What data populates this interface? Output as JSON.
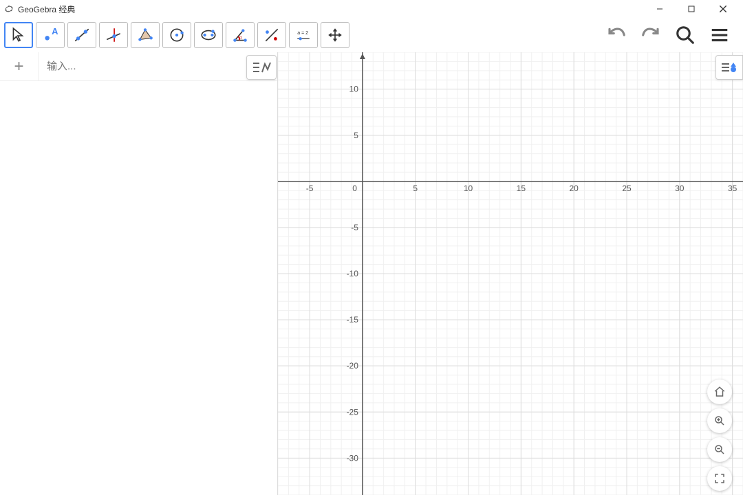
{
  "app": {
    "title": "GeoGebra 经典"
  },
  "toolbar": {
    "slider_label": "a = 2"
  },
  "input": {
    "placeholder": "输入..."
  },
  "chart_data": {
    "type": "scatter",
    "title": "",
    "xlabel": "",
    "ylabel": "",
    "x_ticks": [
      -5,
      0,
      5,
      10,
      15,
      20,
      25,
      30,
      35
    ],
    "y_ticks": [
      10,
      5,
      0,
      -5,
      -10,
      -15,
      -20,
      -25,
      -30
    ],
    "xlim": [
      -8,
      36
    ],
    "ylim": [
      -34,
      14
    ],
    "series": [],
    "grid": true
  }
}
